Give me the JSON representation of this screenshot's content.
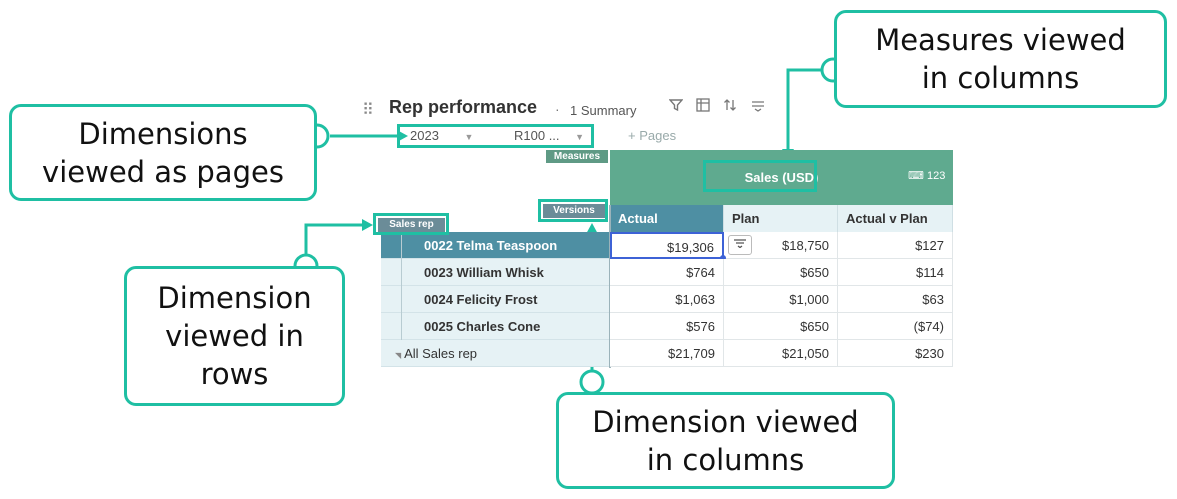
{
  "toolbar": {
    "drag_handle": "⠿",
    "title": "Rep performance",
    "separator": "·",
    "summary": "1 Summary",
    "icons": [
      "filter-icon",
      "pivot-icon",
      "sort-icon",
      "options-icon"
    ]
  },
  "pages": {
    "items": [
      {
        "label": "2023",
        "caret": "▼"
      },
      {
        "label": "R100 ...",
        "caret": "▼"
      }
    ],
    "add_label": "+ Pages"
  },
  "grid": {
    "measures_tag": "Measures",
    "versions_tag": "Versions",
    "sales_rep_tag": "Sales rep",
    "measure_label": "Sales (USD)",
    "measure_format": "123",
    "columns": [
      "Actual",
      "Plan",
      "Actual v Plan"
    ],
    "rows": [
      {
        "label": "0022 Telma Teaspoon",
        "values": [
          "$19,306",
          "$18,750",
          "$127"
        ]
      },
      {
        "label": "0023 William Whisk",
        "values": [
          "$764",
          "$650",
          "$114"
        ]
      },
      {
        "label": "0024 Felicity Frost",
        "values": [
          "$1,063",
          "$1,000",
          "$63"
        ]
      },
      {
        "label": "0025 Charles Cone",
        "values": [
          "$576",
          "$650",
          "($74)"
        ]
      },
      {
        "label": "All Sales rep",
        "values": [
          "$21,709",
          "$21,050",
          "$230"
        ]
      }
    ]
  },
  "callouts": {
    "pages": "Dimensions\nviewed as pages",
    "measures": "Measures viewed\nin columns",
    "rows": "Dimension\nviewed in\nrows",
    "columns": "Dimension viewed\nin columns"
  },
  "colors": {
    "accent": "#1fbfa3",
    "measure_band": "#5faa8f",
    "selected": "#4e8fa3"
  }
}
